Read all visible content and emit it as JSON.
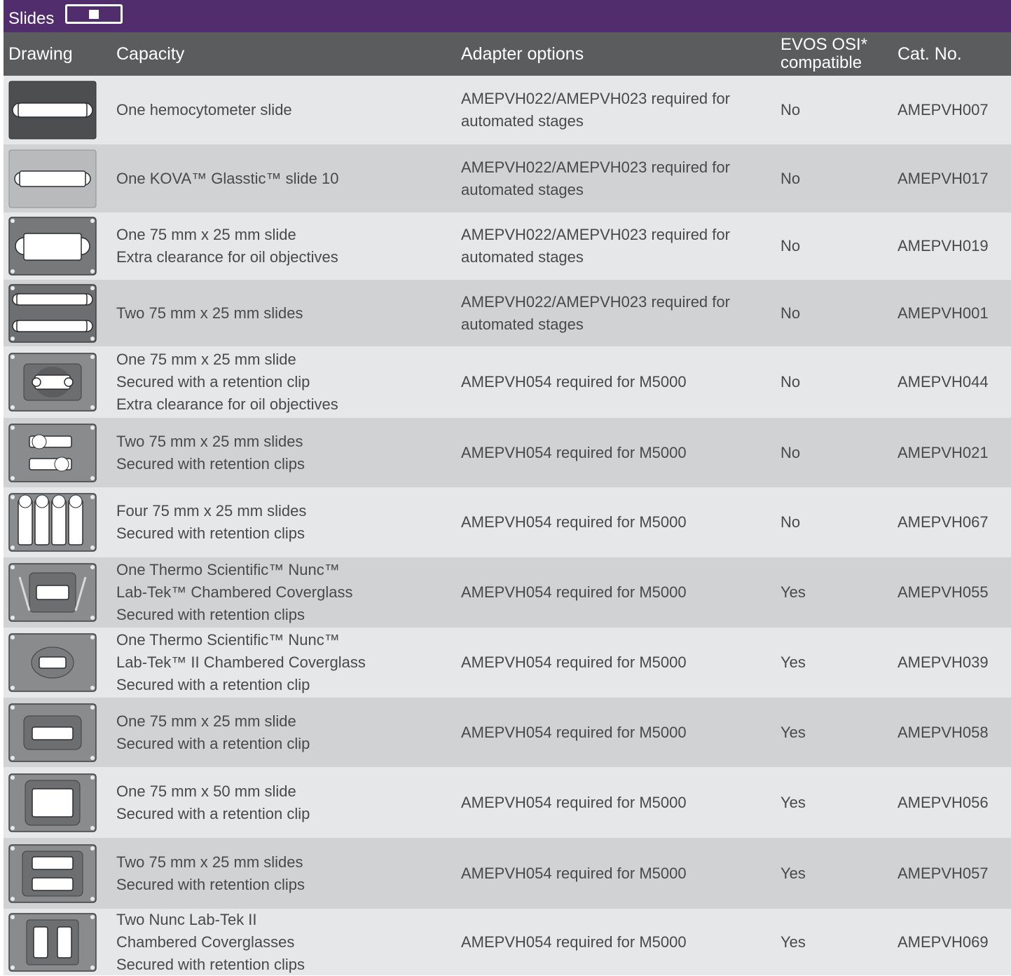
{
  "section": {
    "title": "Slides",
    "icon": "slide-icon"
  },
  "columns": {
    "drawing": "Drawing",
    "capacity": "Capacity",
    "adapter": "Adapter options",
    "osi_line1": "EVOS OSI*",
    "osi_line2": "compatible",
    "cat": "Cat. No."
  },
  "rows": [
    {
      "capacity": [
        "One hemocytometer slide"
      ],
      "adapter": [
        "AMEPVH022/AMEPVH023 required for",
        "automated stages"
      ],
      "osi": "No",
      "cat": "AMEPVH007",
      "drawing": "hemocytometer-holder"
    },
    {
      "capacity": [
        "One KOVA™ Glasstic™ slide 10"
      ],
      "adapter": [
        "AMEPVH022/AMEPVH023 required for",
        "automated stages"
      ],
      "osi": "No",
      "cat": "AMEPVH017",
      "drawing": "kova-slide-holder"
    },
    {
      "capacity": [
        "One 75 mm x 25 mm slide",
        "Extra clearance for oil objectives"
      ],
      "adapter": [
        "AMEPVH022/AMEPVH023 required for",
        "automated stages"
      ],
      "osi": "No",
      "cat": "AMEPVH019",
      "drawing": "single-slide-oil-holder"
    },
    {
      "capacity": [
        "Two 75 mm x 25 mm slides"
      ],
      "adapter": [
        "AMEPVH022/AMEPVH023 required for",
        "automated stages"
      ],
      "osi": "No",
      "cat": "AMEPVH001",
      "drawing": "two-slide-holder"
    },
    {
      "capacity": [
        "One 75 mm x 25 mm slide",
        "Secured with a retention clip",
        "Extra clearance for oil objectives"
      ],
      "adapter": [
        "AMEPVH054 required for M5000"
      ],
      "osi": "No",
      "cat": "AMEPVH044",
      "drawing": "single-slide-clip-oil-holder"
    },
    {
      "capacity": [
        "Two 75 mm x 25 mm slides",
        "Secured with retention clips"
      ],
      "adapter": [
        "AMEPVH054 required for M5000"
      ],
      "osi": "No",
      "cat": "AMEPVH021",
      "drawing": "two-slide-clip-holder"
    },
    {
      "capacity": [
        "Four 75 mm x 25 mm slides",
        "Secured with retention clips"
      ],
      "adapter": [
        "AMEPVH054 required for M5000"
      ],
      "osi": "No",
      "cat": "AMEPVH067",
      "drawing": "four-slide-clip-holder"
    },
    {
      "capacity": [
        "One Thermo Scientific™ Nunc™",
        "Lab-Tek™ Chambered Coverglass",
        "Secured with retention clips"
      ],
      "adapter": [
        "AMEPVH054 required for M5000"
      ],
      "osi": "Yes",
      "cat": "AMEPVH055",
      "drawing": "labtek-coverglass-holder"
    },
    {
      "capacity": [
        "One Thermo Scientific™ Nunc™",
        "Lab-Tek™ II Chambered Coverglass",
        "Secured with a retention clip"
      ],
      "adapter": [
        "AMEPVH054 required for M5000"
      ],
      "osi": "Yes",
      "cat": "AMEPVH039",
      "drawing": "labtek-ii-coverglass-holder"
    },
    {
      "capacity": [
        "One 75 mm x 25 mm slide",
        "Secured with a retention clip"
      ],
      "adapter": [
        "AMEPVH054 required for M5000"
      ],
      "osi": "Yes",
      "cat": "AMEPVH058",
      "drawing": "single-slide-clip-holder"
    },
    {
      "capacity": [
        "One 75 mm x 50 mm slide",
        "Secured with a retention clip"
      ],
      "adapter": [
        "AMEPVH054 required for M5000"
      ],
      "osi": "Yes",
      "cat": "AMEPVH056",
      "drawing": "wide-slide-clip-holder"
    },
    {
      "capacity": [
        "Two 75 mm x 25 mm slides",
        "Secured with retention clips"
      ],
      "adapter": [
        "AMEPVH054 required for M5000"
      ],
      "osi": "Yes",
      "cat": "AMEPVH057",
      "drawing": "two-slide-clip-holder-b"
    },
    {
      "capacity": [
        "Two Nunc Lab-Tek II",
        "Chambered Coverglasses",
        "Secured with retention clips"
      ],
      "adapter": [
        "AMEPVH054 required for M5000"
      ],
      "osi": "Yes",
      "cat": "AMEPVH069",
      "drawing": "two-coverglass-holder"
    }
  ]
}
